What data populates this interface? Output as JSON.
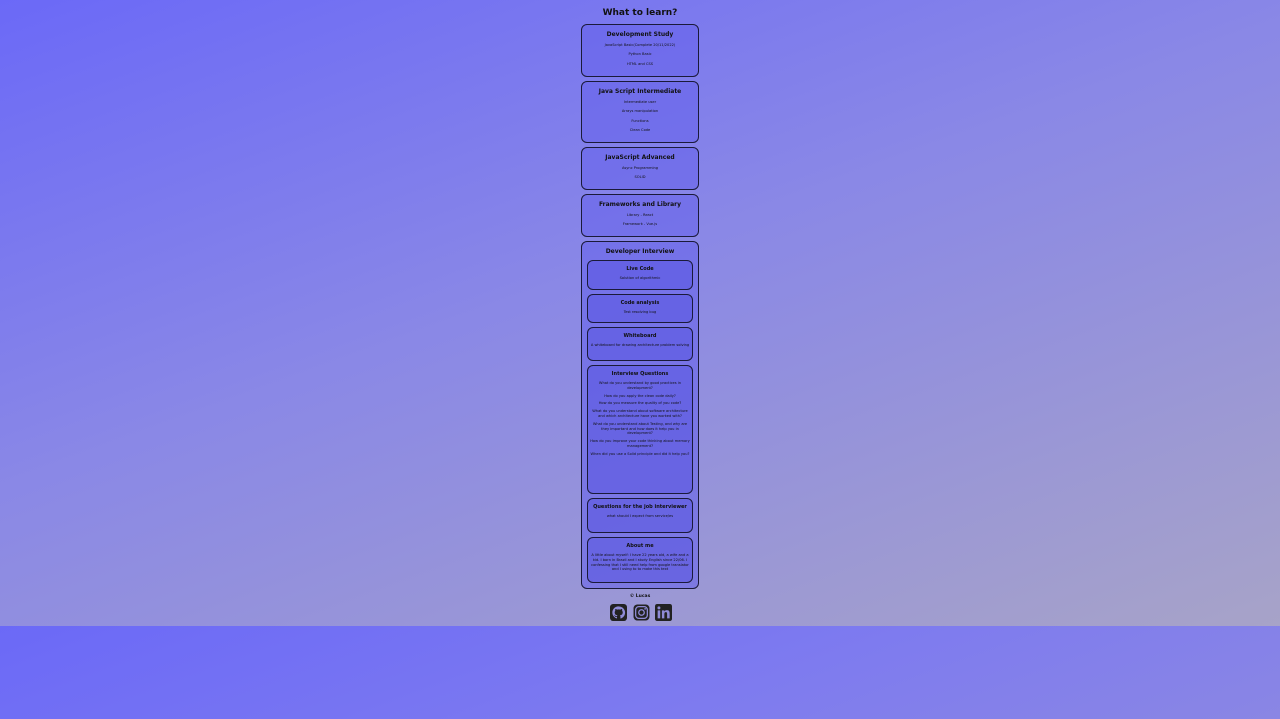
{
  "page": {
    "title": "What to learn?"
  },
  "cards": [
    {
      "title": "Development Study",
      "items": [
        "JavaScript Basic(Complete 20/11/2022)",
        "Python Basic",
        "HTML and CSS"
      ]
    },
    {
      "title": "Java Script Intermediate",
      "items": [
        "Intermediate user",
        "Arrays manipulation",
        "Functions",
        "Clean Code"
      ]
    },
    {
      "title": "JavaScript Advanced",
      "items": [
        "Async Programming",
        "SOLID"
      ]
    },
    {
      "title": "Frameworks and Library",
      "items": [
        "Library - React",
        "Framework - Vue.js"
      ]
    }
  ],
  "interview": {
    "title": "Developer Interview",
    "live_code": {
      "title": "Live Code",
      "text": "Solution of algorithmic"
    },
    "code_analysis": {
      "title": "Code analysis",
      "text": "Test resolving bug"
    },
    "whiteboard": {
      "title": "Whiteboard",
      "text": "A whiteboard for drawing architecture problem solving"
    },
    "questions": {
      "title": "Interview Questions",
      "items": [
        "What do you understand by good practices in development?",
        "How do you apply the clean code daily?",
        "How do you measure the quality of you code?",
        "What do you understand about software architecture and which architecture have you worked with?",
        "What do you understand about Testing, and why are they important and how does it help you in development?",
        "How do you improve your code thinking about memory management?",
        "When did you use a Solid principle and did it help you?"
      ]
    },
    "for_interviewer": {
      "title": "Questions for the job interviewer",
      "text": "what should I expect from service/es"
    },
    "about": {
      "title": "About me",
      "text": "A little about myself: I have 22 years old, a wife and a kid. I born in Brazil and I study English since 22/06. I confessing that I still need help from google translator and I using to to make this text"
    }
  },
  "footer": {
    "text": "© Lucas"
  },
  "socials": [
    {
      "icon": "github-icon",
      "color": "#222222"
    },
    {
      "icon": "instagram-icon",
      "color": "#222222"
    },
    {
      "icon": "linkedin-icon",
      "color": "#222222"
    }
  ]
}
